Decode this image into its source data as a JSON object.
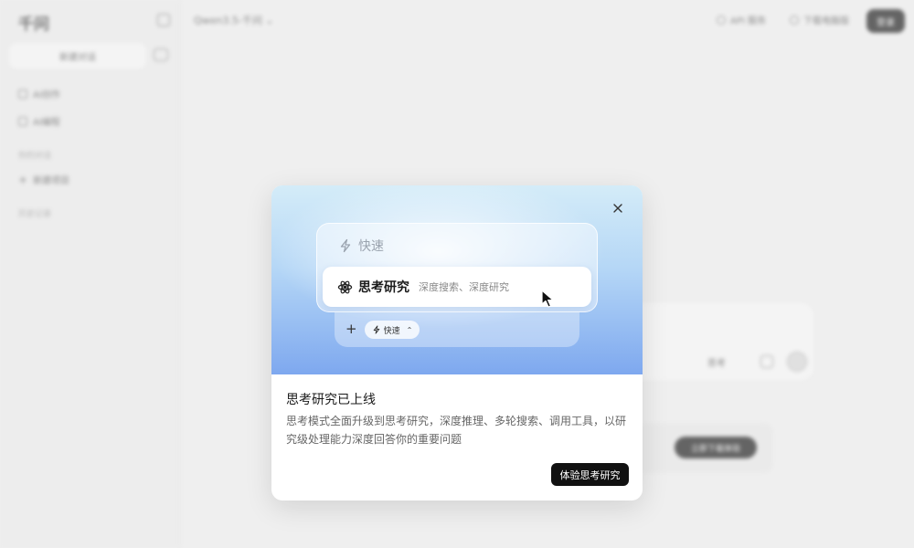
{
  "app": {
    "brand": "千问",
    "new_chat_label": "新建对话",
    "nav": [
      {
        "label": "AI创作",
        "icon": "sparkle-icon"
      },
      {
        "label": "AI编程",
        "icon": "code-icon"
      }
    ],
    "section_recent": "你的对话",
    "new_project_label": "新建项目",
    "section_history": "历史记录",
    "model_selector": "Qwen3.5-千问",
    "top_actions": [
      {
        "label": "API 服务",
        "icon": "api-icon"
      },
      {
        "label": "下载电脑版",
        "icon": "download-icon"
      }
    ],
    "login_label": "登录",
    "input_think_label": "思考",
    "banner_button_label": "立即下载体验"
  },
  "modal": {
    "fast_label": "快速",
    "think_label": "思考研究",
    "think_desc": "深度搜索、深度研究",
    "mini_chip_label": "快速",
    "title": "思考研究已上线",
    "description": "思考模式全面升级到思考研究，深度推理、多轮搜索、调用工具，以研究级处理能力深度回答你的重要问题",
    "cta_label": "体验思考研究"
  },
  "colors": {
    "hero_top": "#d4ecf8",
    "hero_bottom": "#7ea8ef",
    "cta_bg": "#111111"
  }
}
